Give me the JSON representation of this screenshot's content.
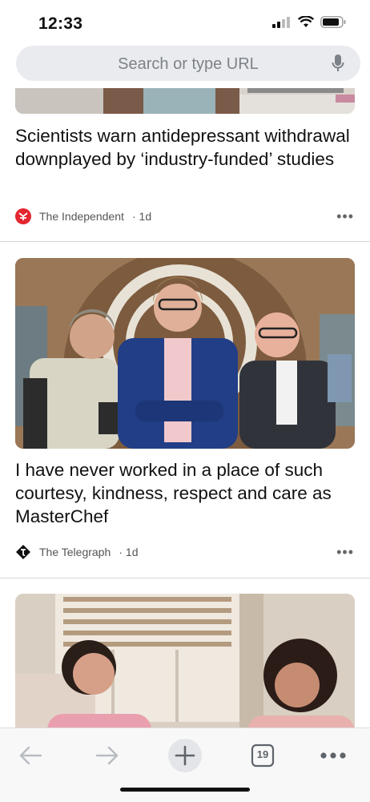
{
  "status_bar": {
    "time": "12:33"
  },
  "search": {
    "placeholder": "Search or type URL"
  },
  "articles": [
    {
      "headline": "Scientists warn antidepressant withdrawal downplayed by ‘industry-funded’ studies",
      "source": "The Independent",
      "age": "1d"
    },
    {
      "headline": "I have never worked in a place of such courtesy, kindness, respect and care as MasterChef",
      "source": "The Telegraph",
      "age": "1d"
    },
    {
      "headline": "",
      "source": "",
      "age": ""
    }
  ],
  "toolbar": {
    "tab_count": "19"
  },
  "colors": {
    "independent_red": "#e3262f",
    "toolbar_bg": "#f8f8f8",
    "url_bg": "#e9ebee"
  }
}
